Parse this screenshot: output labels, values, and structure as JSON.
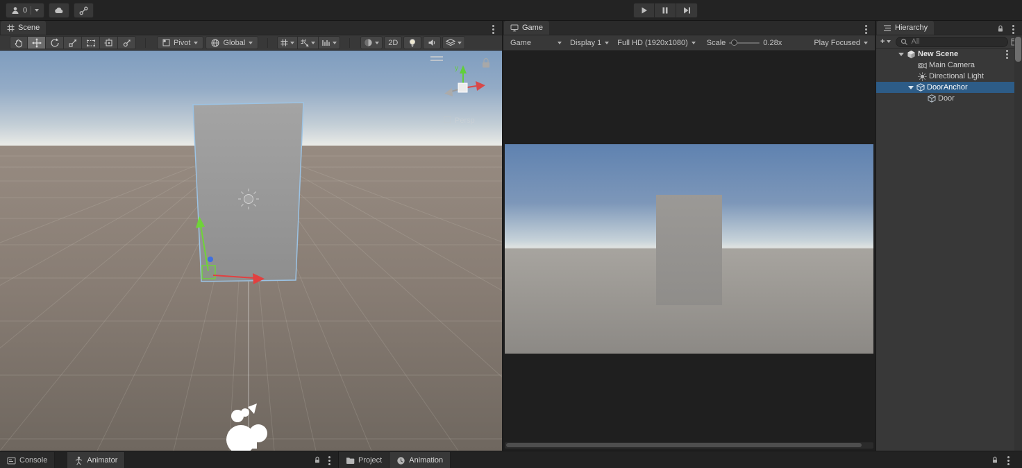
{
  "topbar": {
    "version_badge": "0"
  },
  "scene": {
    "tab": "Scene",
    "toolbar": {
      "pivot": "Pivot",
      "handle_space": "Global",
      "mode_2d": "2D"
    },
    "view_gizmo": {
      "axis_label": "y",
      "projection": "Persp"
    }
  },
  "game": {
    "tab": "Game",
    "toolbar": {
      "target": "Game",
      "display": "Display 1",
      "resolution": "Full HD (1920x1080)",
      "scale_label": "Scale",
      "scale_value": "0.28x",
      "focus_mode": "Play Focused"
    }
  },
  "hierarchy": {
    "tab": "Hierarchy",
    "add_button": "+",
    "search_placeholder": "All",
    "tree": [
      {
        "label": "New Scene",
        "depth": 0,
        "type": "scene",
        "expanded": true
      },
      {
        "label": "Main Camera",
        "depth": 1,
        "type": "camera"
      },
      {
        "label": "Directional Light",
        "depth": 1,
        "type": "light"
      },
      {
        "label": "DoorAnchor",
        "depth": 1,
        "type": "gameobject",
        "expanded": true,
        "selected": true
      },
      {
        "label": "Door",
        "depth": 2,
        "type": "gameobject"
      }
    ]
  },
  "bottom": {
    "left_tabs": [
      {
        "label": "Console"
      },
      {
        "label": "Animator",
        "active": true
      }
    ],
    "right_tabs": [
      {
        "label": "Project"
      },
      {
        "label": "Animation",
        "active": true
      }
    ]
  },
  "icons": {
    "topbar": [
      "person-icon",
      "cloud-icon",
      "link-icon",
      "play-icon",
      "pause-icon",
      "step-icon"
    ],
    "scene_tools": [
      "hand-tool-icon",
      "move-tool-icon",
      "rotate-tool-icon",
      "scale-tool-icon",
      "rect-tool-icon",
      "transform-tool-icon",
      "custom-tool-icon",
      "pivot-icon",
      "globe-icon",
      "grid-snap-icon",
      "snap-move-icon",
      "ruler-icon",
      "shaded-sphere-icon",
      "lightbulb-icon",
      "speaker-icon",
      "effects-icon"
    ],
    "misc": [
      "search-icon",
      "plus-icon",
      "lock-icon",
      "kebab-icon",
      "folder-icon",
      "clock-icon",
      "console-icon",
      "animator-icon",
      "cube-icon",
      "camera-icon",
      "sun-icon"
    ]
  },
  "colors": {
    "selection_blue": "#2d5c87",
    "axis_x_red": "#d94848",
    "axis_y_green": "#61cf3a",
    "axis_z_blue": "#3f6fe0",
    "panel_bg": "#383838",
    "dark_bg": "#232323"
  }
}
